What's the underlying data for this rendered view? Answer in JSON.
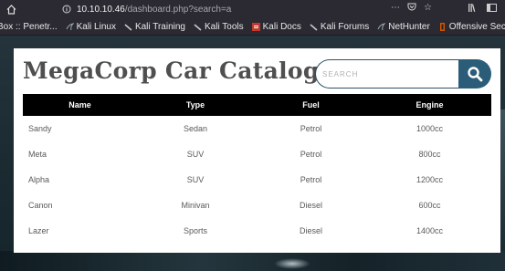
{
  "browser": {
    "url_host": "10.10.10.46",
    "url_path": "/dashboard.php?search=a",
    "bookmarks": [
      {
        "label": "Box :: Penetr..."
      },
      {
        "label": "Kali Linux"
      },
      {
        "label": "Kali Training"
      },
      {
        "label": "Kali Tools"
      },
      {
        "label": "Kali Docs"
      },
      {
        "label": "Kali Forums"
      },
      {
        "label": "NetHunter"
      },
      {
        "label": "Offensive Security"
      }
    ]
  },
  "page": {
    "title": "MegaCorp Car Catalogue",
    "search_placeholder": "SEARCH",
    "search_value": ""
  },
  "table": {
    "headers": [
      "Name",
      "Type",
      "Fuel",
      "Engine"
    ],
    "rows": [
      [
        "Sandy",
        "Sedan",
        "Petrol",
        "1000cc"
      ],
      [
        "Meta",
        "SUV",
        "Petrol",
        "800cc"
      ],
      [
        "Alpha",
        "SUV",
        "Petrol",
        "1200cc"
      ],
      [
        "Canon",
        "Minivan",
        "Diesel",
        "600cc"
      ],
      [
        "Lazer",
        "Sports",
        "Diesel",
        "1400cc"
      ]
    ]
  },
  "colors": {
    "accent": "#2c5d78",
    "header_bg": "#000000",
    "title": "#4f4f4f"
  }
}
